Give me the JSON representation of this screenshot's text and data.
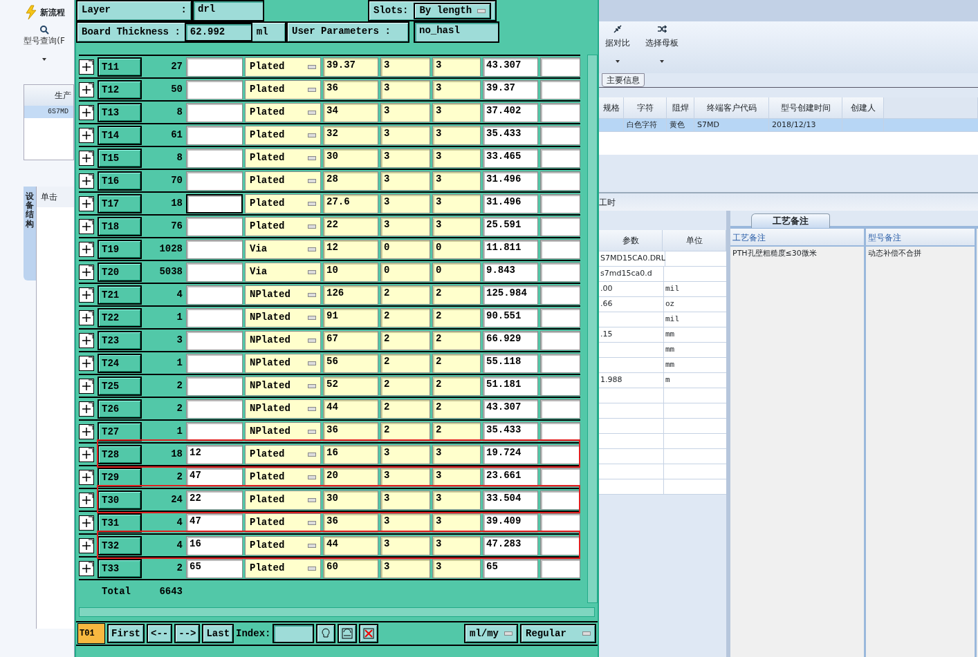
{
  "left_app": {
    "ribbon_title": "新流程",
    "search_button": "型号查询(F",
    "grid_header": "生产",
    "grid_row": "6S7MD",
    "side_tab": "设备结构",
    "tree_hint": "单击"
  },
  "dialog": {
    "layer_label": "Layer",
    "layer_colon": ":",
    "layer_value": "drl",
    "slots_label": "Slots:",
    "slots_value": "By length",
    "thickness_label": "Board Thickness :",
    "thickness_value": "62.992",
    "thickness_unit": "ml",
    "user_params_label": "User Parameters :",
    "user_params_value": "no_hasl",
    "rows": [
      {
        "tool": "T11",
        "count": "27",
        "type": "Plated",
        "size": "39.37",
        "tol_plus": "3",
        "tol_minus": "3",
        "drill": "43.307",
        "focused": false,
        "highlighted": false
      },
      {
        "tool": "T12",
        "count": "50",
        "type": "Plated",
        "size": "36",
        "tol_plus": "3",
        "tol_minus": "3",
        "drill": "39.37",
        "focused": false,
        "highlighted": false
      },
      {
        "tool": "T13",
        "count": "8",
        "type": "Plated",
        "size": "34",
        "tol_plus": "3",
        "tol_minus": "3",
        "drill": "37.402",
        "focused": false,
        "highlighted": false
      },
      {
        "tool": "T14",
        "count": "61",
        "type": "Plated",
        "size": "32",
        "tol_plus": "3",
        "tol_minus": "3",
        "drill": "35.433",
        "focused": false,
        "highlighted": false
      },
      {
        "tool": "T15",
        "count": "8",
        "type": "Plated",
        "size": "30",
        "tol_plus": "3",
        "tol_minus": "3",
        "drill": "33.465",
        "focused": false,
        "highlighted": false
      },
      {
        "tool": "T16",
        "count": "70",
        "type": "Plated",
        "size": "28",
        "tol_plus": "3",
        "tol_minus": "3",
        "drill": "31.496",
        "focused": false,
        "highlighted": false
      },
      {
        "tool": "T17",
        "count": "18",
        "type": "Plated",
        "size": "27.6",
        "tol_plus": "3",
        "tol_minus": "3",
        "drill": "31.496",
        "focused": true,
        "highlighted": false
      },
      {
        "tool": "T18",
        "count": "76",
        "type": "Plated",
        "size": "22",
        "tol_plus": "3",
        "tol_minus": "3",
        "drill": "25.591",
        "focused": false,
        "highlighted": false
      },
      {
        "tool": "T19",
        "count": "1028",
        "type": "Via",
        "size": "12",
        "tol_plus": "0",
        "tol_minus": "0",
        "drill": "11.811",
        "focused": false,
        "highlighted": false
      },
      {
        "tool": "T20",
        "count": "5038",
        "type": "Via",
        "size": "10",
        "tol_plus": "0",
        "tol_minus": "0",
        "drill": "9.843",
        "focused": false,
        "highlighted": false
      },
      {
        "tool": "T21",
        "count": "4",
        "type": "NPlated",
        "size": "126",
        "tol_plus": "2",
        "tol_minus": "2",
        "drill": "125.984",
        "focused": false,
        "highlighted": false
      },
      {
        "tool": "T22",
        "count": "1",
        "type": "NPlated",
        "size": "91",
        "tol_plus": "2",
        "tol_minus": "2",
        "drill": "90.551",
        "focused": false,
        "highlighted": false
      },
      {
        "tool": "T23",
        "count": "3",
        "type": "NPlated",
        "size": "67",
        "tol_plus": "2",
        "tol_minus": "2",
        "drill": "66.929",
        "focused": false,
        "highlighted": false
      },
      {
        "tool": "T24",
        "count": "1",
        "type": "NPlated",
        "size": "56",
        "tol_plus": "2",
        "tol_minus": "2",
        "drill": "55.118",
        "focused": false,
        "highlighted": false
      },
      {
        "tool": "T25",
        "count": "2",
        "type": "NPlated",
        "size": "52",
        "tol_plus": "2",
        "tol_minus": "2",
        "drill": "51.181",
        "focused": false,
        "highlighted": false
      },
      {
        "tool": "T26",
        "count": "2",
        "type": "NPlated",
        "size": "44",
        "tol_plus": "2",
        "tol_minus": "2",
        "drill": "43.307",
        "focused": false,
        "highlighted": false
      },
      {
        "tool": "T27",
        "count": "1",
        "type": "NPlated",
        "size": "36",
        "tol_plus": "2",
        "tol_minus": "2",
        "drill": "35.433",
        "focused": false,
        "highlighted": false
      },
      {
        "tool": "T28",
        "count": "18",
        "note": "12",
        "type": "Plated",
        "size": "16",
        "tol_plus": "3",
        "tol_minus": "3",
        "drill": "19.724",
        "focused": false,
        "highlighted": true
      },
      {
        "tool": "T29",
        "count": "2",
        "note": "47",
        "type": "Plated",
        "size": "20",
        "tol_plus": "3",
        "tol_minus": "3",
        "drill": "23.661",
        "focused": false,
        "highlighted": false
      },
      {
        "tool": "T30",
        "count": "24",
        "note": "22",
        "type": "Plated",
        "size": "30",
        "tol_plus": "3",
        "tol_minus": "3",
        "drill": "33.504",
        "focused": false,
        "highlighted": true
      },
      {
        "tool": "T31",
        "count": "4",
        "note": "47",
        "type": "Plated",
        "size": "36",
        "tol_plus": "3",
        "tol_minus": "3",
        "drill": "39.409",
        "focused": false,
        "highlighted": false
      },
      {
        "tool": "T32",
        "count": "4",
        "note": "16",
        "type": "Plated",
        "size": "44",
        "tol_plus": "3",
        "tol_minus": "3",
        "drill": "47.283",
        "focused": false,
        "highlighted": true
      },
      {
        "tool": "T33",
        "count": "2",
        "note": "65",
        "type": "Plated",
        "size": "60",
        "tol_plus": "3",
        "tol_minus": "3",
        "drill": "65",
        "focused": false,
        "highlighted": false
      }
    ],
    "total": {
      "label": "Total",
      "count": "6643"
    },
    "footer": {
      "current": "T01",
      "buttons": [
        "First",
        "<--",
        "-->",
        "Last"
      ],
      "index_label": "Index:",
      "units": "ml/my",
      "mode": "Regular"
    }
  },
  "right_app": {
    "ribbon_buttons": [
      {
        "label": "据对比",
        "kind": "compare"
      },
      {
        "label": "选择母板",
        "kind": "shuffle"
      }
    ],
    "group_tab": "主要信息",
    "grid": [
      {
        "header": "规格"
      },
      {
        "header": "字符",
        "value": "白色字符"
      },
      {
        "header": "阻焊",
        "value": "黄色"
      },
      {
        "header": "终端客户代码",
        "value": "S7MD"
      },
      {
        "header": "型号创建时间",
        "value": "2018/12/13"
      },
      {
        "header": "创建人"
      }
    ],
    "grid_row_selected": true,
    "section": "工时",
    "param_columns": [
      "参数",
      "单位"
    ],
    "params": [
      {
        "param": "S7MD15CA0.DRL"
      },
      {
        "param": "s7md15ca0.d"
      },
      {
        "param": ".00",
        "unit": "mil"
      },
      {
        "param": ".66",
        "unit": "oz"
      },
      {
        "unit": "mil"
      },
      {
        "param": ".15",
        "unit": "mm"
      },
      {
        "unit": "mm"
      },
      {
        "unit": "mm"
      },
      {
        "param": "1.988",
        "unit": "m"
      }
    ],
    "notes_tab": "工艺备注",
    "notes": [
      {
        "header": "工艺备注",
        "value": "PTH孔壁粗糙度≤30微米"
      },
      {
        "header": "型号备注",
        "value": "动态补偿不合拼"
      }
    ]
  }
}
